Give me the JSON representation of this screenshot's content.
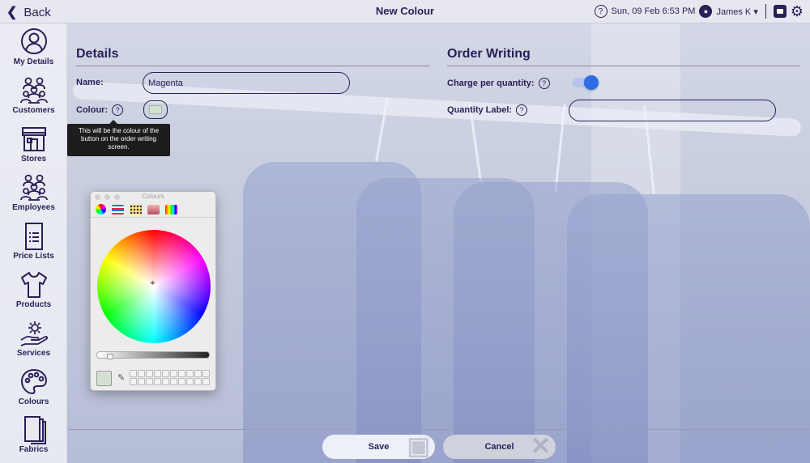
{
  "topbar": {
    "back_label": "Back",
    "title": "New Colour",
    "help_glyph": "?",
    "datetime": "Sun, 09 Feb 6:53 PM",
    "user_name": "James K",
    "user_caret": "▾"
  },
  "sidebar": {
    "items": [
      {
        "label": "My Details",
        "icon": "user-circle-icon"
      },
      {
        "label": "Customers",
        "icon": "customers-icon"
      },
      {
        "label": "Stores",
        "icon": "store-icon"
      },
      {
        "label": "Employees",
        "icon": "employees-icon"
      },
      {
        "label": "Price Lists",
        "icon": "price-list-icon"
      },
      {
        "label": "Products",
        "icon": "tshirt-icon"
      },
      {
        "label": "Services",
        "icon": "services-gear-hand-icon"
      },
      {
        "label": "Colours",
        "icon": "palette-icon"
      },
      {
        "label": "Fabrics",
        "icon": "fabric-book-icon"
      }
    ]
  },
  "details": {
    "heading": "Details",
    "name_label": "Name:",
    "name_value": "Magenta",
    "colour_label": "Colour:",
    "colour_value_hex": "#d3e2d0",
    "tooltip": "This will be the colour of the button on the order writing screen."
  },
  "order_writing": {
    "heading": "Order Writing",
    "charge_label": "Charge per quantity:",
    "charge_enabled": true,
    "quantity_label": "Quantity Label:",
    "quantity_value": ""
  },
  "colour_panel": {
    "title": "Colours",
    "brightness": 0.1
  },
  "actions": {
    "save_label": "Save",
    "cancel_label": "Cancel"
  },
  "colors": {
    "accent": "#2a1f57",
    "toggle_on": "#2f6de0"
  }
}
